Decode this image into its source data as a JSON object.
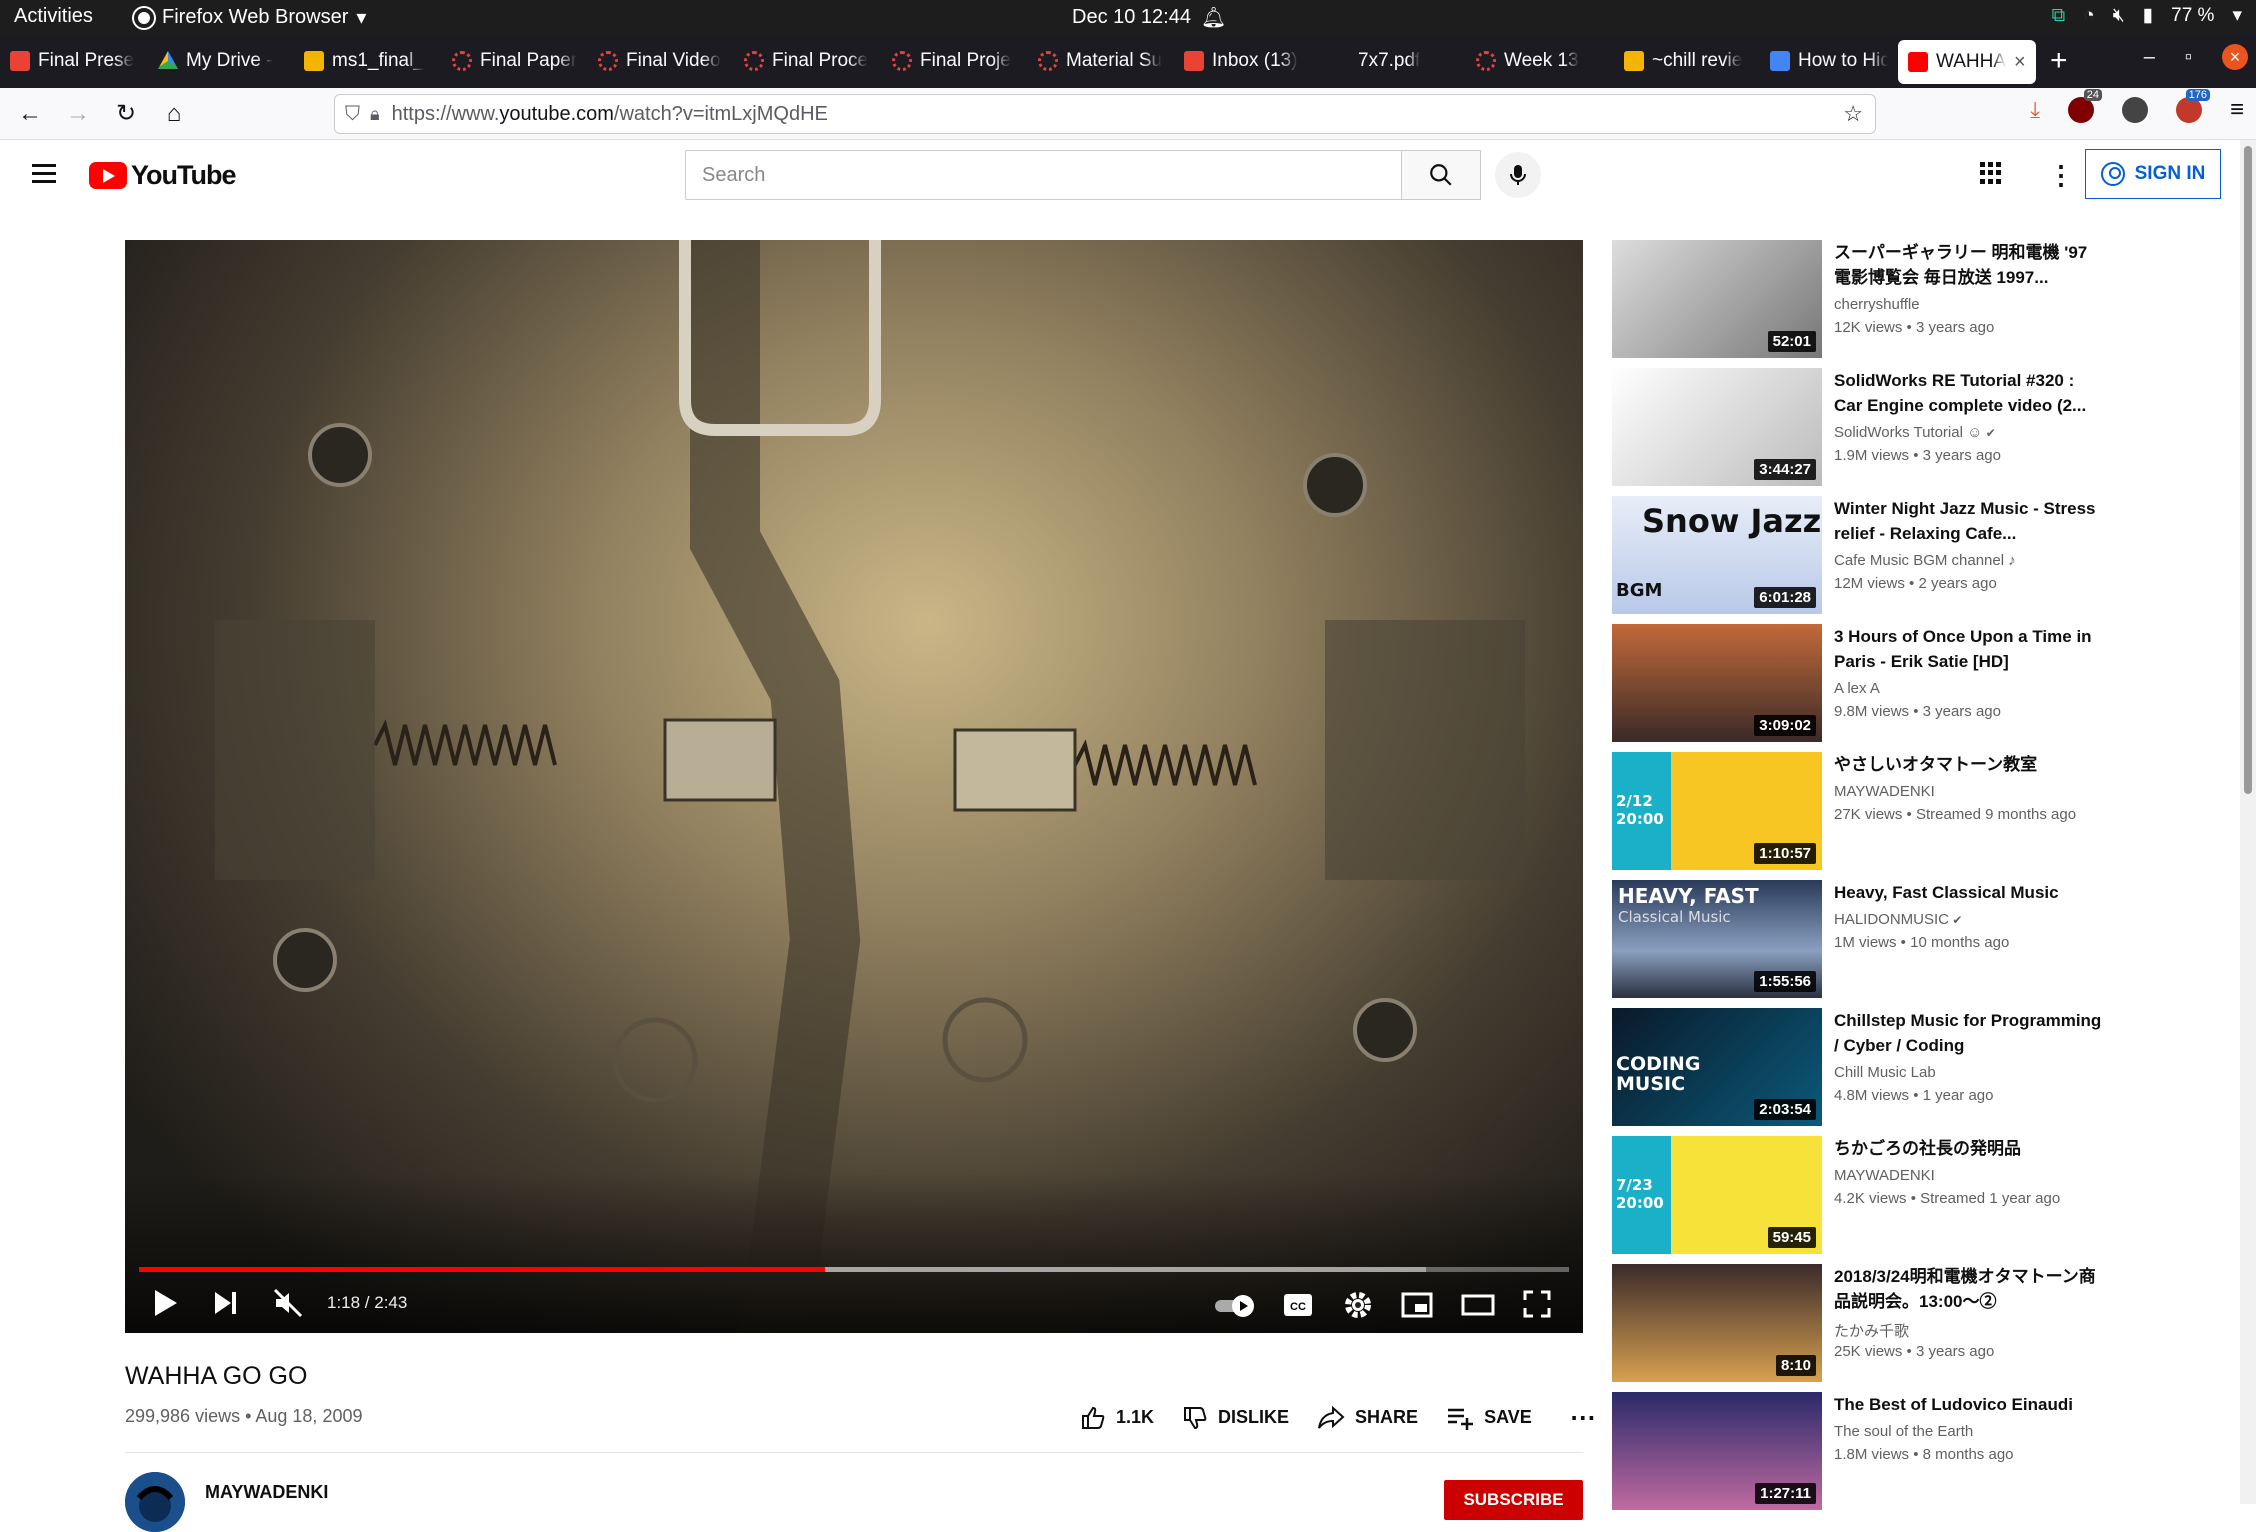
{
  "gnome": {
    "activities": "Activities",
    "app_menu": "Firefox Web Browser",
    "clock": "Dec 10  12:44",
    "battery": "77 %"
  },
  "tabs": [
    {
      "label": "Final Prese",
      "icon": "gmail-icon",
      "color": "#ea4335"
    },
    {
      "label": "My Drive -",
      "icon": "drive-icon",
      "color": "#34a853"
    },
    {
      "label": "ms1_final_",
      "icon": "slides-icon",
      "color": "#f4b400"
    },
    {
      "label": "Final Paper",
      "icon": "spinner-icon",
      "color": "#e0443e"
    },
    {
      "label": "Final Video",
      "icon": "spinner-icon",
      "color": "#e0443e"
    },
    {
      "label": "Final Proce",
      "icon": "spinner-icon",
      "color": "#e0443e"
    },
    {
      "label": "Final Proje",
      "icon": "spinner-icon",
      "color": "#e0443e"
    },
    {
      "label": "Material Su",
      "icon": "spinner-icon",
      "color": "#e0443e"
    },
    {
      "label": "Inbox (13)",
      "icon": "gmail-icon",
      "color": "#ea4335"
    },
    {
      "label": "7x7.pdf",
      "icon": "pdf-icon",
      "color": "#1c1b22"
    },
    {
      "label": "Week 13",
      "icon": "spinner-icon",
      "color": "#e0443e"
    },
    {
      "label": "~chill revie",
      "icon": "slides-icon",
      "color": "#f4b400"
    },
    {
      "label": "How to Hid",
      "icon": "docs-icon",
      "color": "#4285f4"
    },
    {
      "label": "WAHHA",
      "icon": "youtube-icon",
      "color": "#ff0000",
      "active": true
    }
  ],
  "address": {
    "prefix": "https://www.",
    "host": "youtube.com",
    "path": "/watch?v=itmLxjMQdHE"
  },
  "extensions": {
    "badge1": "24",
    "badge2": "176"
  },
  "youtube": {
    "logo_text": "YouTube",
    "search_placeholder": "Search",
    "sign_in": "SIGN IN"
  },
  "player": {
    "current_time": "1:18",
    "duration": "2:43",
    "time_label": "1:18 / 2:43",
    "played_fraction": 0.48,
    "buffered_fraction": 0.9
  },
  "video": {
    "title": "WAHHA GO GO",
    "views": "299,986 views",
    "date": "Aug 18, 2009",
    "meta": "299,986 views • Aug 18, 2009",
    "likes": "1.1K",
    "dislike": "DISLIKE",
    "share": "SHARE",
    "save": "SAVE",
    "channel": "MAYWADENKI",
    "subscribe": "SUBSCRIBE"
  },
  "related": [
    {
      "title": "スーパーギャラリー 明和電機 '97電影博覧会 毎日放送 1997...",
      "channel": "cherryshuffle",
      "stats": "12K views • 3 years ago",
      "duration": "52:01",
      "verified": false
    },
    {
      "title": "SolidWorks RE Tutorial #320 : Car Engine complete video (2...",
      "channel": "SolidWorks Tutorial ☺",
      "stats": "1.9M views • 3 years ago",
      "duration": "3:44:27",
      "verified": true
    },
    {
      "title": "Winter Night Jazz Music - Stress relief - Relaxing Cafe...",
      "channel": "Cafe Music BGM channel",
      "stats": "12M views • 2 years ago",
      "duration": "6:01:28",
      "verified": false,
      "music": true,
      "thumb_text": "Snow Jazz",
      "thumb_sub": "BGM"
    },
    {
      "title": "3 Hours of Once Upon a Time in Paris - Erik Satie [HD]",
      "channel": "A lex A",
      "stats": "9.8M views • 3 years ago",
      "duration": "3:09:02",
      "verified": false
    },
    {
      "title": "やさしいオタマトーン教室",
      "channel": "MAYWADENKI",
      "stats": "27K views • Streamed 9 months ago",
      "duration": "1:10:57",
      "verified": false,
      "thumb_text": "2/12 20:00"
    },
    {
      "title": "Heavy, Fast Classical Music",
      "channel": "HALIDONMUSIC",
      "stats": "1M views • 10 months ago",
      "duration": "1:55:56",
      "verified": true,
      "thumb_text": "HEAVY, FAST",
      "thumb_sub": "Classical Music"
    },
    {
      "title": "Chillstep Music for Programming / Cyber / Coding",
      "channel": "Chill Music Lab",
      "stats": "4.8M views • 1 year ago",
      "duration": "2:03:54",
      "verified": false,
      "thumb_text": "CODING MUSIC"
    },
    {
      "title": "ちかごろの社長の発明品",
      "channel": "MAYWADENKI",
      "stats": "4.2K views • Streamed 1 year ago",
      "duration": "59:45",
      "verified": false,
      "thumb_text": "7/23 20:00"
    },
    {
      "title": "2018/3/24明和電機オタマトーン商品説明会。13:00〜②",
      "channel": "たかみ千歌",
      "stats": "25K views • 3 years ago",
      "duration": "8:10",
      "verified": false
    },
    {
      "title": "The Best of Ludovico Einaudi",
      "channel": "The soul of the Earth",
      "stats": "1.8M views • 8 months ago",
      "duration": "1:27:11",
      "verified": false
    }
  ],
  "colors": {
    "accent": "#ff0000",
    "link": "#065fd4",
    "subscribe": "#cc0000"
  }
}
